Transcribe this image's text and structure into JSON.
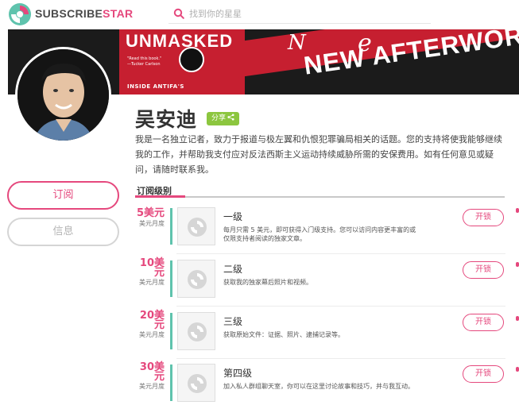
{
  "brand": {
    "part1": "SUBSCRIBE",
    "part2": "STAR",
    "accent": "#e5487d"
  },
  "search": {
    "placeholder": "找到你的星星",
    "icon": "search-icon"
  },
  "cover": {
    "book_title": "UNMASKED",
    "book_quote": "\"Read this book.\"\n—Tucker Carlson",
    "book_tagline": "INSIDE ANTIFA'S",
    "script_text": "N",
    "script_text2": "e",
    "headline": "NEW AFTERWORD"
  },
  "profile": {
    "name": "吴安迪",
    "share_label": "分享",
    "description": "我是一名独立记者，致力于报道与极左翼和仇恨犯罪骗局相关的话题。您的支持将使我能够继续我的工作，并帮助我支付应对反法西斯主义运动持续威胁所需的安保费用。如有任何意见或疑问，请随时联系我。"
  },
  "actions": {
    "subscribe_label": "订阅",
    "message_label": "信息"
  },
  "tiers_tab_label": "订阅级别",
  "tiers": [
    {
      "price": "5美元",
      "period": "美元月度",
      "title": "一级",
      "description": "每月只需 5 美元，即可获得入门级支持。您可以访问内容更丰富的或仅限支持者阅读的独家文章。",
      "unlock_label": "开锁"
    },
    {
      "price": "10美元",
      "period": "美元月度",
      "title": "二级",
      "description": "获取我的独家幕后照片和视频。",
      "unlock_label": "开锁"
    },
    {
      "price": "20美元",
      "period": "美元月度",
      "title": "三级",
      "description": "获取原始文件：证据、照片、逮捕记录等。",
      "unlock_label": "开锁"
    },
    {
      "price": "30美元",
      "period": "美元月度",
      "title": "第四级",
      "description": "加入私人群组聊天室，你可以在这里讨论故事和技巧，并与我互动。",
      "unlock_label": "开锁"
    }
  ]
}
